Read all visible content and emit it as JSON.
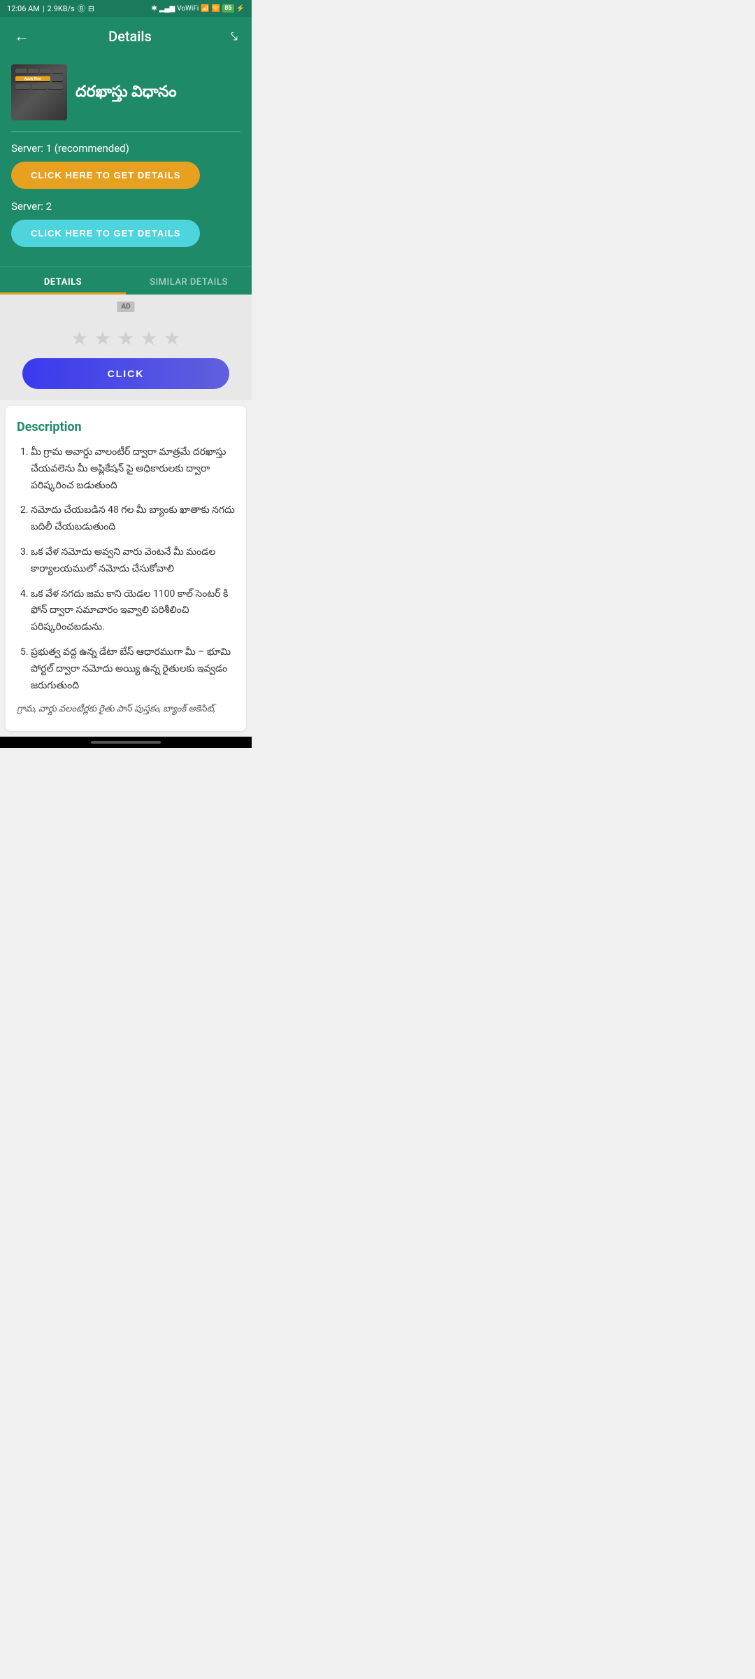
{
  "statusBar": {
    "time": "12:06 AM",
    "speed": "2.9KB/s",
    "battery": "85"
  },
  "appBar": {
    "title": "Details",
    "backIcon": "←",
    "shareIcon": "⤴"
  },
  "article": {
    "thumbnail_alt": "Apply Now keyboard image",
    "apply_now_text": "Apply Now",
    "title": "దరఖాస్తు విధానం"
  },
  "servers": {
    "server1Label": "Server: 1 (recommended)",
    "server1Button": "CLICK HERE TO GET DETAILS",
    "server2Label": "Server: 2",
    "server2Button": "CLICK HERE TO GET DETAILS"
  },
  "tabs": {
    "detailsLabel": "DETAILS",
    "similarLabel": "SIMILAR DETAILS"
  },
  "ad": {
    "label": "AD",
    "clickButton": "CLICK"
  },
  "description": {
    "title": "Description",
    "items": [
      "మీ గ్రామ అవార్డు వాలంటీర్ ద్వారా మాత్రమే దరఖాస్తు చేయవలెను మీ అప్లికేషన్ పై అధికారులకు ద్వారా పరిష్కరించ బడుతుంది",
      "నమోదు చేయబడిన 48 గల మీ బ్యాంకు ఖాతాకు నగదు బదిలీ చేయబడుతుంది",
      "ఒక వేళ నమోదు అవ్వని వారు వెంటనే మీ మండల కార్యాలయములో నమోదు చేసుకోవాలి",
      "ఒక వేళ నగదు జమ కాని యెడల 1100 కాల్ సెంటర్ కి ఫోన్ ద్వారా సమాచారం ఇవ్వాలి పరిశీలించి పరిష్కరించబడును.",
      "ప్రభుత్వ వద్ద ఉన్న డేటా బేస్ ఆధారముగా మీ – భూమి పోర్టల్ ద్వారా నమోదు అయ్యి ఉన్న రైతులకు ఇవ్వడం జరుగుతుంది"
    ],
    "footer": "గ్రామ, వార్డు వలంటీర్లకు రైతు పాస్ పుస్తకం, బ్యాంక్ అకెసిట్,"
  }
}
